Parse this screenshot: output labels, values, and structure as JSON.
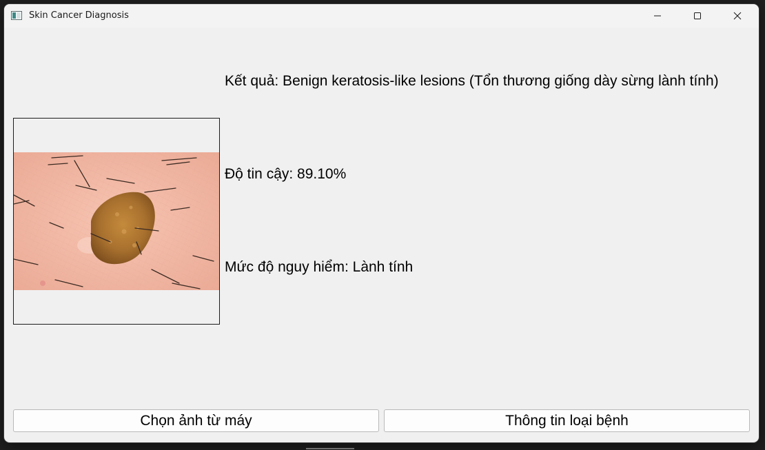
{
  "window": {
    "title": "Skin Cancer Diagnosis",
    "icon": "app-window-icon"
  },
  "controls": {
    "minimize_icon": "minimize-icon",
    "maximize_icon": "maximize-icon",
    "close_icon": "close-icon"
  },
  "result": {
    "diagnosis_text": "Kết quả: Benign keratosis-like lesions (Tổn thương giống dày sừng lành tính)",
    "confidence_text": "Độ tin cậy: 89.10%",
    "risk_text": "Mức độ nguy hiểm: Lành tính"
  },
  "buttons": {
    "choose_image": "Chọn ảnh từ máy",
    "disease_info": "Thông tin loại bệnh"
  },
  "colors": {
    "window_bg": "#f0f0f0",
    "skin": "#f2b4a0",
    "lesion": "#a8702e"
  }
}
